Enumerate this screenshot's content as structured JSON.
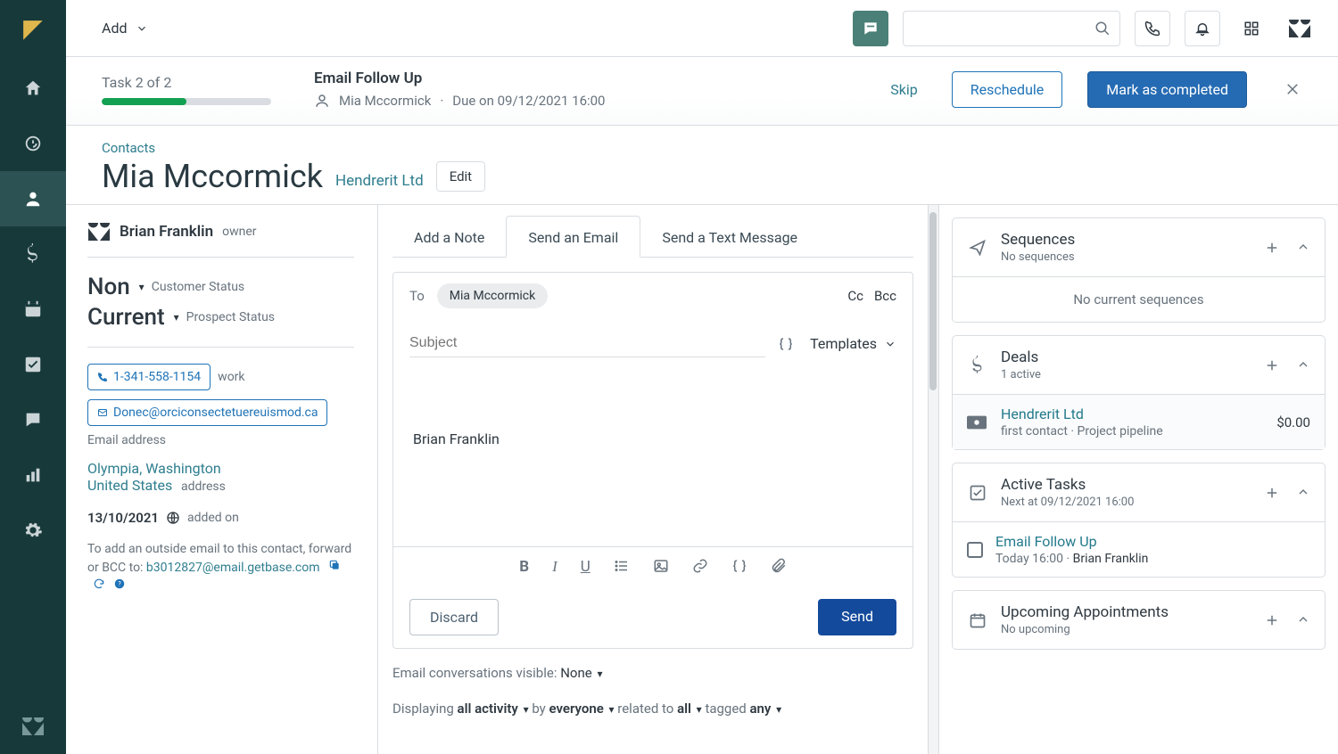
{
  "topbar": {
    "add_label": "Add",
    "search_placeholder": ""
  },
  "taskbar": {
    "counter": "Task 2 of 2",
    "progress_pct": 50,
    "title": "Email Follow Up",
    "assignee": "Mia Mccormick",
    "due": "Due on 09/12/2021 16:00",
    "skip": "Skip",
    "reschedule": "Reschedule",
    "complete": "Mark as completed"
  },
  "header": {
    "breadcrumb": "Contacts",
    "name": "Mia Mccormick",
    "company": "Hendrerit Ltd",
    "edit": "Edit"
  },
  "left": {
    "owner_name": "Brian Franklin",
    "owner_label": "owner",
    "customer_status_value": "Non",
    "customer_status_label": "Customer Status",
    "prospect_status_value": "Current",
    "prospect_status_label": "Prospect Status",
    "phone": "1-341-558-1154",
    "phone_label": "work",
    "email": "Donec@orciconsectetuereuismod.ca",
    "email_label": "Email address",
    "address_line1": "Olympia, Washington",
    "address_line2": "United States",
    "address_label": "address",
    "added_date": "13/10/2021",
    "added_label": "added on",
    "bcc_note_prefix": "To add an outside email to this contact, forward or BCC to: ",
    "bcc_email": "b3012827@email.getbase.com"
  },
  "compose": {
    "tabs": [
      "Add a Note",
      "Send an Email",
      "Send a Text Message"
    ],
    "active_tab": 1,
    "to_label": "To",
    "to_chip": "Mia Mccormick",
    "cc": "Cc",
    "bcc": "Bcc",
    "subject_placeholder": "Subject",
    "templates": "Templates",
    "body_text": "Brian Franklin",
    "discard": "Discard",
    "send": "Send",
    "visibility_prefix": "Email conversations visible: ",
    "visibility_value": "None",
    "filter_displaying": "Displaying ",
    "filter_activity": "all activity",
    "filter_by": " by ",
    "filter_everyone": "everyone",
    "filter_related": " related to ",
    "filter_all": "all",
    "filter_tagged": " tagged ",
    "filter_any": "any"
  },
  "right": {
    "sequences": {
      "title": "Sequences",
      "sub": "No sequences",
      "empty": "No current sequences"
    },
    "deals": {
      "title": "Deals",
      "sub": "1 active",
      "item_title": "Hendrerit Ltd",
      "item_amount": "$0.00",
      "item_sub": "first contact · Project pipeline"
    },
    "tasks": {
      "title": "Active Tasks",
      "sub": "Next at 09/12/2021 16:00",
      "item_title": "Email Follow Up",
      "item_sub_time": "Today 16:00 · ",
      "item_sub_name": "Brian Franklin"
    },
    "appointments": {
      "title": "Upcoming Appointments",
      "sub": "No upcoming"
    }
  }
}
